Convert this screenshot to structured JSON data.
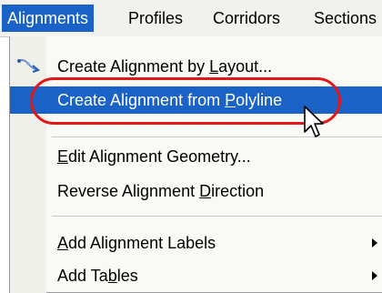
{
  "menubar": {
    "items": [
      {
        "label": "Alignments",
        "active": true
      },
      {
        "label": "Profiles"
      },
      {
        "label": "Corridors"
      },
      {
        "label": "Sections"
      }
    ]
  },
  "menu": {
    "items": [
      {
        "pre": "Create Alignment by ",
        "ul": "L",
        "post": "ayout...",
        "icon": "alignment-layout-icon"
      },
      {
        "pre": "Create Alignment from ",
        "ul": "P",
        "post": "olyline",
        "highlighted": true
      },
      {
        "pre": "",
        "ul": "E",
        "post": "dit Alignment Geometry..."
      },
      {
        "pre": "Reverse Alignment ",
        "ul": "D",
        "post": "irection"
      },
      {
        "pre": "",
        "ul": "A",
        "post": "dd Alignment Labels",
        "submenu": true
      },
      {
        "pre": "Add Ta",
        "ul": "b",
        "post": "les",
        "submenu": true
      }
    ]
  },
  "colors": {
    "highlight": "#1a62c6",
    "annotation_oval": "#e01818"
  }
}
